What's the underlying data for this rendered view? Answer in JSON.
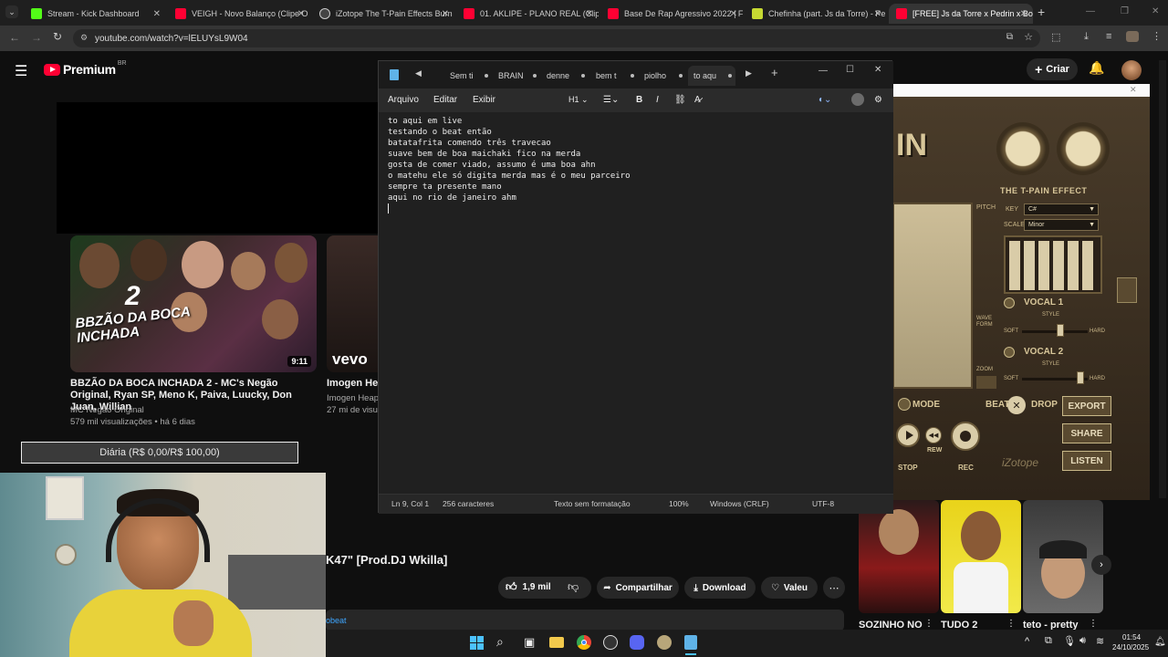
{
  "browser": {
    "tabs": [
      {
        "label": "Stream - Kick Dashboard",
        "color": "#53fc18"
      },
      {
        "label": "VEIGH - Novo Balanço (Clipe O",
        "color": "#ff0033"
      },
      {
        "label": "iZotope The T-Pain Effects Burn",
        "color": "#dddddd"
      },
      {
        "label": "01. AKLIPE - PLANO REAL (Clip",
        "color": "#ff0033"
      },
      {
        "label": "Base De Rap Agressivo 2022 | F",
        "color": "#ff0033"
      },
      {
        "label": "Chefinha (part. Js da Torre) - Pe",
        "color": "#c6d932"
      },
      {
        "label": "[FREE] Js da Torre x Pedrin x Bo",
        "color": "#ff0033"
      }
    ],
    "url": "youtube.com/watch?v=lELUYsL9W04"
  },
  "youtube": {
    "logo": "Premium",
    "region": "BR",
    "create_label": "Criar",
    "videos": [
      {
        "title": "BBZÃO DA BOCA INCHADA 2 - MC's Negão Original, Ryan SP, Meno K, Paiva, Luucky, Don Juan, Willian",
        "channel": "MC Negão Original",
        "stats": "579 mil visualizações • há 6 dias",
        "duration": "9:11",
        "thumb_text": "BBZÃO DA BOCA INCHADA"
      },
      {
        "title": "Imogen Hea",
        "channel": "Imogen Heap",
        "stats": "27 mi de visu",
        "thumb_text": "vevo"
      }
    ],
    "donation_label": "Diária (R$ 0,00/R$ 100,00)",
    "main_title_fragment": "K47\" [Prod.DJ Wkilla]",
    "likes": "1,9 mil",
    "share_label": "Compartilhar",
    "download_label": "Download",
    "thanks_label": "Valeu",
    "desc_fragment": "obeat",
    "shorts": [
      "SOZINHO NO",
      "TUDO 2",
      "teto - pretty"
    ]
  },
  "notepad": {
    "tabs": [
      "Sem ti",
      "BRAIN",
      "denne",
      "bem t",
      "piolho",
      "to aqu"
    ],
    "menu": [
      "Arquivo",
      "Editar",
      "Exibir"
    ],
    "heading": "H1",
    "lines": [
      "to aqui em live",
      "testando o beat então",
      "batatafrita comendo três travecao",
      "suave bem de boa maichaki fico na merda",
      "gosta de comer viado, assumo é uma boa ahn",
      "o matehu ele só digita merda mas é o meu parceiro",
      "sempre ta presente mano",
      "aqui no rio de janeiro ahm"
    ],
    "status": {
      "position": "Ln 9, Col 1",
      "chars": "256 caracteres",
      "format": "Texto sem formatação",
      "zoom": "100%",
      "eol": "Windows (CRLF)",
      "encoding": "UTF-8"
    }
  },
  "tpain": {
    "title": "THE T-PAIN EFFECT",
    "key_label": "KEY",
    "key_value": "C#",
    "scale_label": "SCALE",
    "scale_value": "Minor",
    "pitch_label": "PITCH",
    "wave_label": "WAVE FORM",
    "zoom_label": "ZOOM",
    "vocal1": "VOCAL 1",
    "vocal2": "VOCAL 2",
    "style": "STYLE",
    "soft": "SOFT",
    "hard": "HARD",
    "mode": "MODE",
    "beat": "BEAT",
    "drop": "DROP",
    "export": "EXPORT",
    "share": "SHARE",
    "listen": "LISTEN",
    "stop": "STOP",
    "rec": "REC",
    "rew": "REW",
    "brand": "iZotope"
  },
  "taskbar": {
    "time": "01:54",
    "date": "24/10/2025"
  }
}
